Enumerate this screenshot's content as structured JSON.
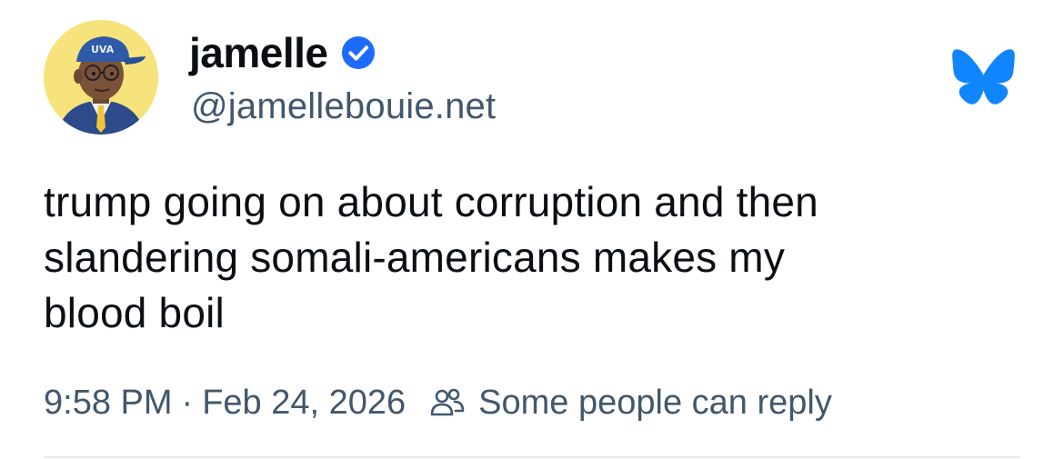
{
  "post": {
    "author": {
      "display_name": "jamelle",
      "handle": "@jamellebouie.net",
      "verified": true,
      "avatar_cap_text": "UVA"
    },
    "text": "trump going on about corruption and then\nslandering somali-americans makes my\nblood boil",
    "time": "9:58 PM",
    "separator": "·",
    "date": "Feb 24, 2026",
    "reply_setting": "Some people can reply"
  },
  "icons": {
    "verified": "verified-check-icon",
    "platform": "bluesky-butterfly-icon",
    "reply_setting": "people-icon"
  },
  "colors": {
    "verified_blue": "#1d6bfa",
    "bluesky_blue": "#1185fe",
    "muted_text": "#42576c",
    "text": "#0b0f14"
  }
}
